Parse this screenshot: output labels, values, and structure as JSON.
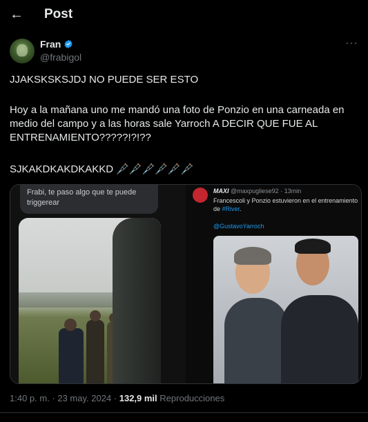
{
  "header": {
    "back_label": "←",
    "title": "Post"
  },
  "author": {
    "name": "Fran",
    "handle": "@frabigol",
    "verified": true
  },
  "post": {
    "line1": "JJAKSKSKSJDJ NO PUEDE SER ESTO",
    "line2": "Hoy a la mañana uno me mandó una foto de Ponzio en una carneada en medio del campo y a las horas sale Yarroch A DECIR QUE FUE AL ENTRENAMIENTO?????!?!??",
    "line3": "SJKAKDKAKDKAKKD 🩼🩼🩼🩼🩼🩼"
  },
  "media": {
    "left_bubble_text": "Frabi, te paso algo que te puede triggerear",
    "right_tweet": {
      "name": "MAXI",
      "handle": "@maxpugliese92 · 13min",
      "text_prefix": "Francescoli y Ponzio estuvieron en el entrenamiento de ",
      "hashtag": "#River",
      "text_suffix": ".",
      "mention": "@GustavoYarroch"
    }
  },
  "footer": {
    "time": "1:40 p. m. · 23 may. 2024 · ",
    "views_count": "132,9 mil",
    "views_label": " Reproducciones"
  },
  "colors": {
    "background": "#000000",
    "text": "#e7e9ea",
    "muted": "#71767b",
    "accent": "#1d9bf0"
  },
  "icons": {
    "back": "arrow-left-icon",
    "verified": "verified-badge-icon",
    "more": "more-icon"
  }
}
